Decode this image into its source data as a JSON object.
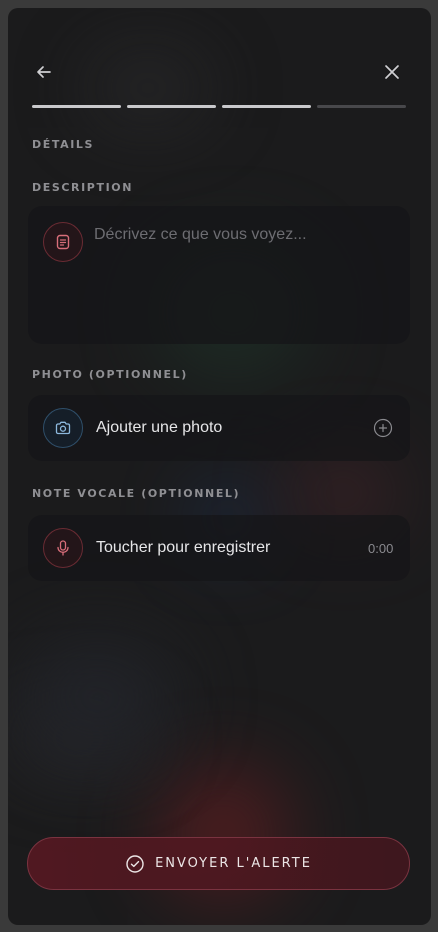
{
  "nav": {
    "back_icon": "arrow-left-icon",
    "close_icon": "close-icon"
  },
  "progress": {
    "steps_total": 4,
    "steps_completed": 3,
    "active_color": "#c9c9cc",
    "inactive_color": "#48484b"
  },
  "section_title": "DÉTAILS",
  "description": {
    "label": "DESCRIPTION",
    "icon": "document-icon",
    "placeholder": "Décrivez ce que vous voyez...",
    "value": ""
  },
  "photo": {
    "label": "PHOTO (OPTIONNEL)",
    "icon": "camera-icon",
    "action_text": "Ajouter une photo",
    "add_icon": "plus-circle-icon"
  },
  "voice": {
    "label": "NOTE VOCALE (OPTIONNEL)",
    "icon": "microphone-icon",
    "action_text": "Toucher pour enregistrer",
    "duration": "0:00"
  },
  "submit": {
    "label": "ENVOYER L'ALERTE",
    "icon": "check-circle-icon"
  },
  "colors": {
    "accent_red": "#b2454f",
    "accent_blue": "#4f7ea8",
    "background": "#1b1b1c"
  }
}
